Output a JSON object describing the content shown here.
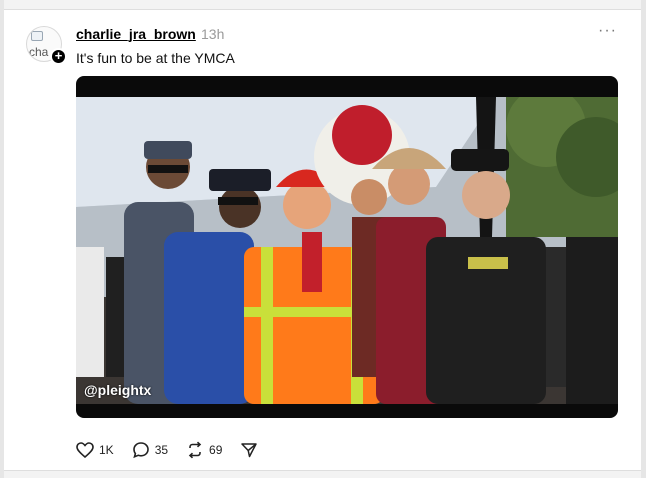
{
  "post": {
    "username": "charlie_jra_brown",
    "timestamp": "13h",
    "avatar_alt": "cha",
    "follow_badge": "+",
    "more_label": "···",
    "text": "It's fun to be at the YMCA",
    "image_watermark": "@pleightx"
  },
  "actions": {
    "likes": "1K",
    "replies": "35",
    "reposts": "69"
  },
  "icons": [
    "heart-icon",
    "comment-icon",
    "repost-icon",
    "share-icon",
    "more-icon",
    "plus-icon"
  ],
  "colors": {
    "accent": "#000000",
    "muted": "#9a9a9a",
    "vest_orange": "#ff7a1a",
    "hat_red": "#d8281f"
  }
}
